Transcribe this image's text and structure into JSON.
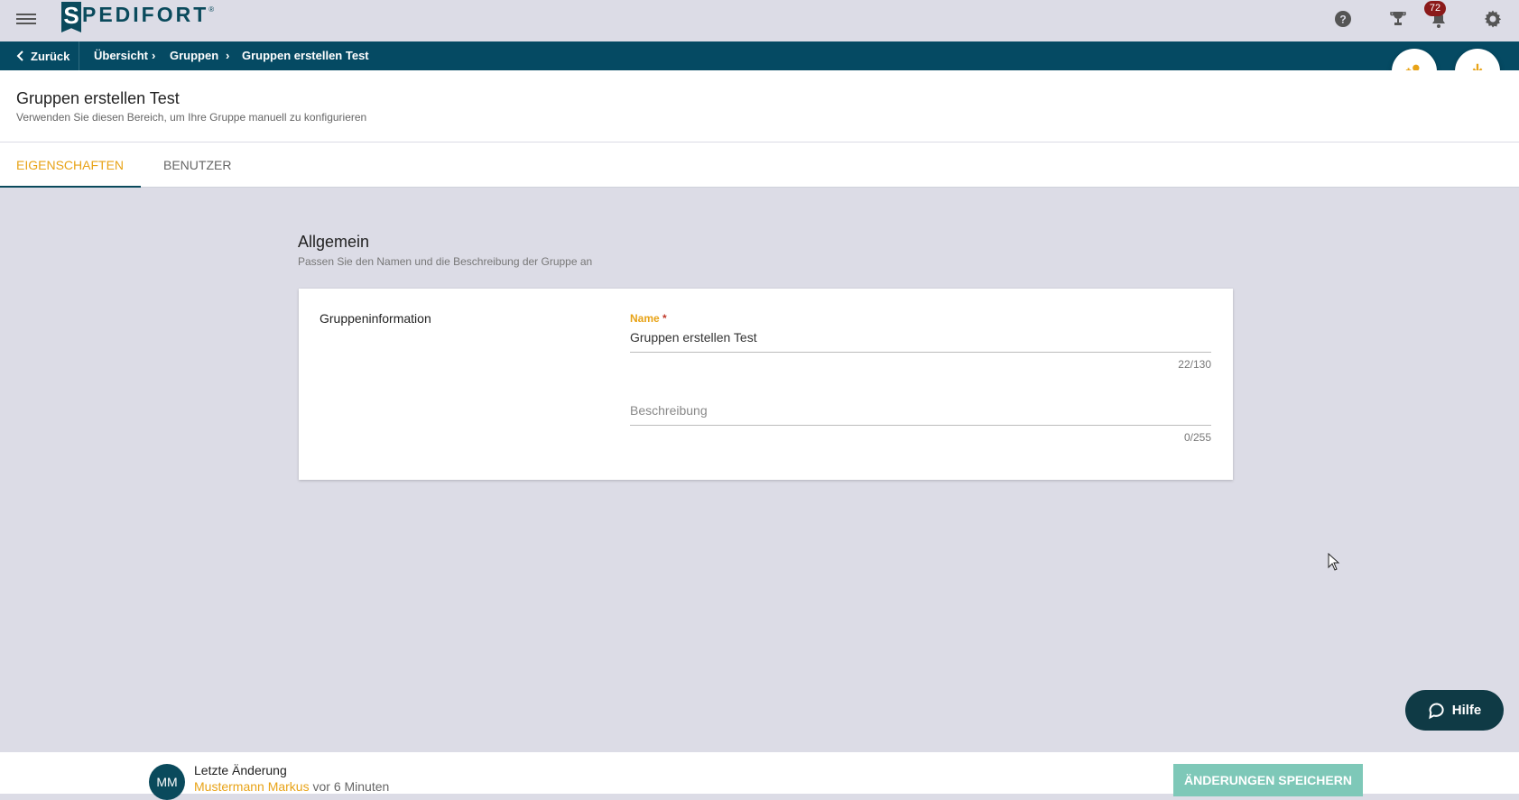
{
  "app": {
    "logo_letter": "S",
    "logo_text": "PEDIFORT",
    "logo_reg": "®",
    "notification_count": "72"
  },
  "breadcrumb": {
    "back_label": "Zurück",
    "items": [
      "Übersicht",
      "Gruppen",
      "Gruppen erstellen Test"
    ],
    "separator": "›"
  },
  "header": {
    "title": "Gruppen erstellen Test",
    "subtitle": "Verwenden Sie diesen Bereich, um Ihre Gruppe manuell zu konfigurieren"
  },
  "tabs": [
    {
      "label": "EIGENSCHAFTEN",
      "active": true
    },
    {
      "label": "BENUTZER",
      "active": false
    }
  ],
  "section": {
    "title": "Allgemein",
    "subtitle": "Passen Sie den Namen und die Beschreibung der Gruppe an"
  },
  "card": {
    "label": "Gruppeninformation",
    "name_field": {
      "label": "Name",
      "required_marker": "*",
      "value": "Gruppen erstellen Test",
      "counter": "22/130"
    },
    "description_field": {
      "placeholder": "Beschreibung",
      "value": "",
      "counter": "0/255"
    }
  },
  "help_button": {
    "label": "Hilfe"
  },
  "footer": {
    "avatar_initials": "MM",
    "last_change_label": "Letzte Änderung",
    "last_change_user": "Mustermann Markus",
    "last_change_time": "vor 6 Minuten",
    "save_label": "ÄNDERUNGEN SPEICHERN"
  },
  "colors": {
    "accent": "#e8a317",
    "brand": "#0a4a5c",
    "breadcrumb_bg": "#054a63",
    "save_button": "#7ec8b8",
    "help_button": "#0f3a45"
  },
  "icons": {
    "menu": "menu-icon",
    "help": "help-circle-icon",
    "trophy": "trophy-icon",
    "bell": "bell-icon",
    "settings": "gear-icon",
    "add_user": "add-user-icon",
    "download": "download-icon",
    "chat": "chat-icon"
  }
}
